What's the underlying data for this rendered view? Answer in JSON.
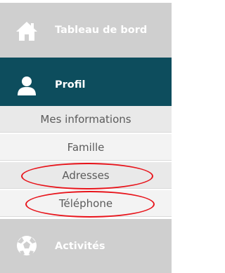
{
  "menu": {
    "dashboard": {
      "label": "Tableau de bord",
      "icon": "home-icon"
    },
    "profil": {
      "label": "Profil",
      "icon": "user-icon"
    },
    "submenu": [
      {
        "label": "Mes informations"
      },
      {
        "label": "Famille"
      },
      {
        "label": "Adresses"
      },
      {
        "label": "Téléphone"
      }
    ],
    "activites": {
      "label": "Activités",
      "icon": "soccer-ball-icon"
    }
  },
  "colors": {
    "profil_bg": "#0d4d5d",
    "inactive_bg": "#cfcfcf",
    "annotation": "#e8141b"
  }
}
